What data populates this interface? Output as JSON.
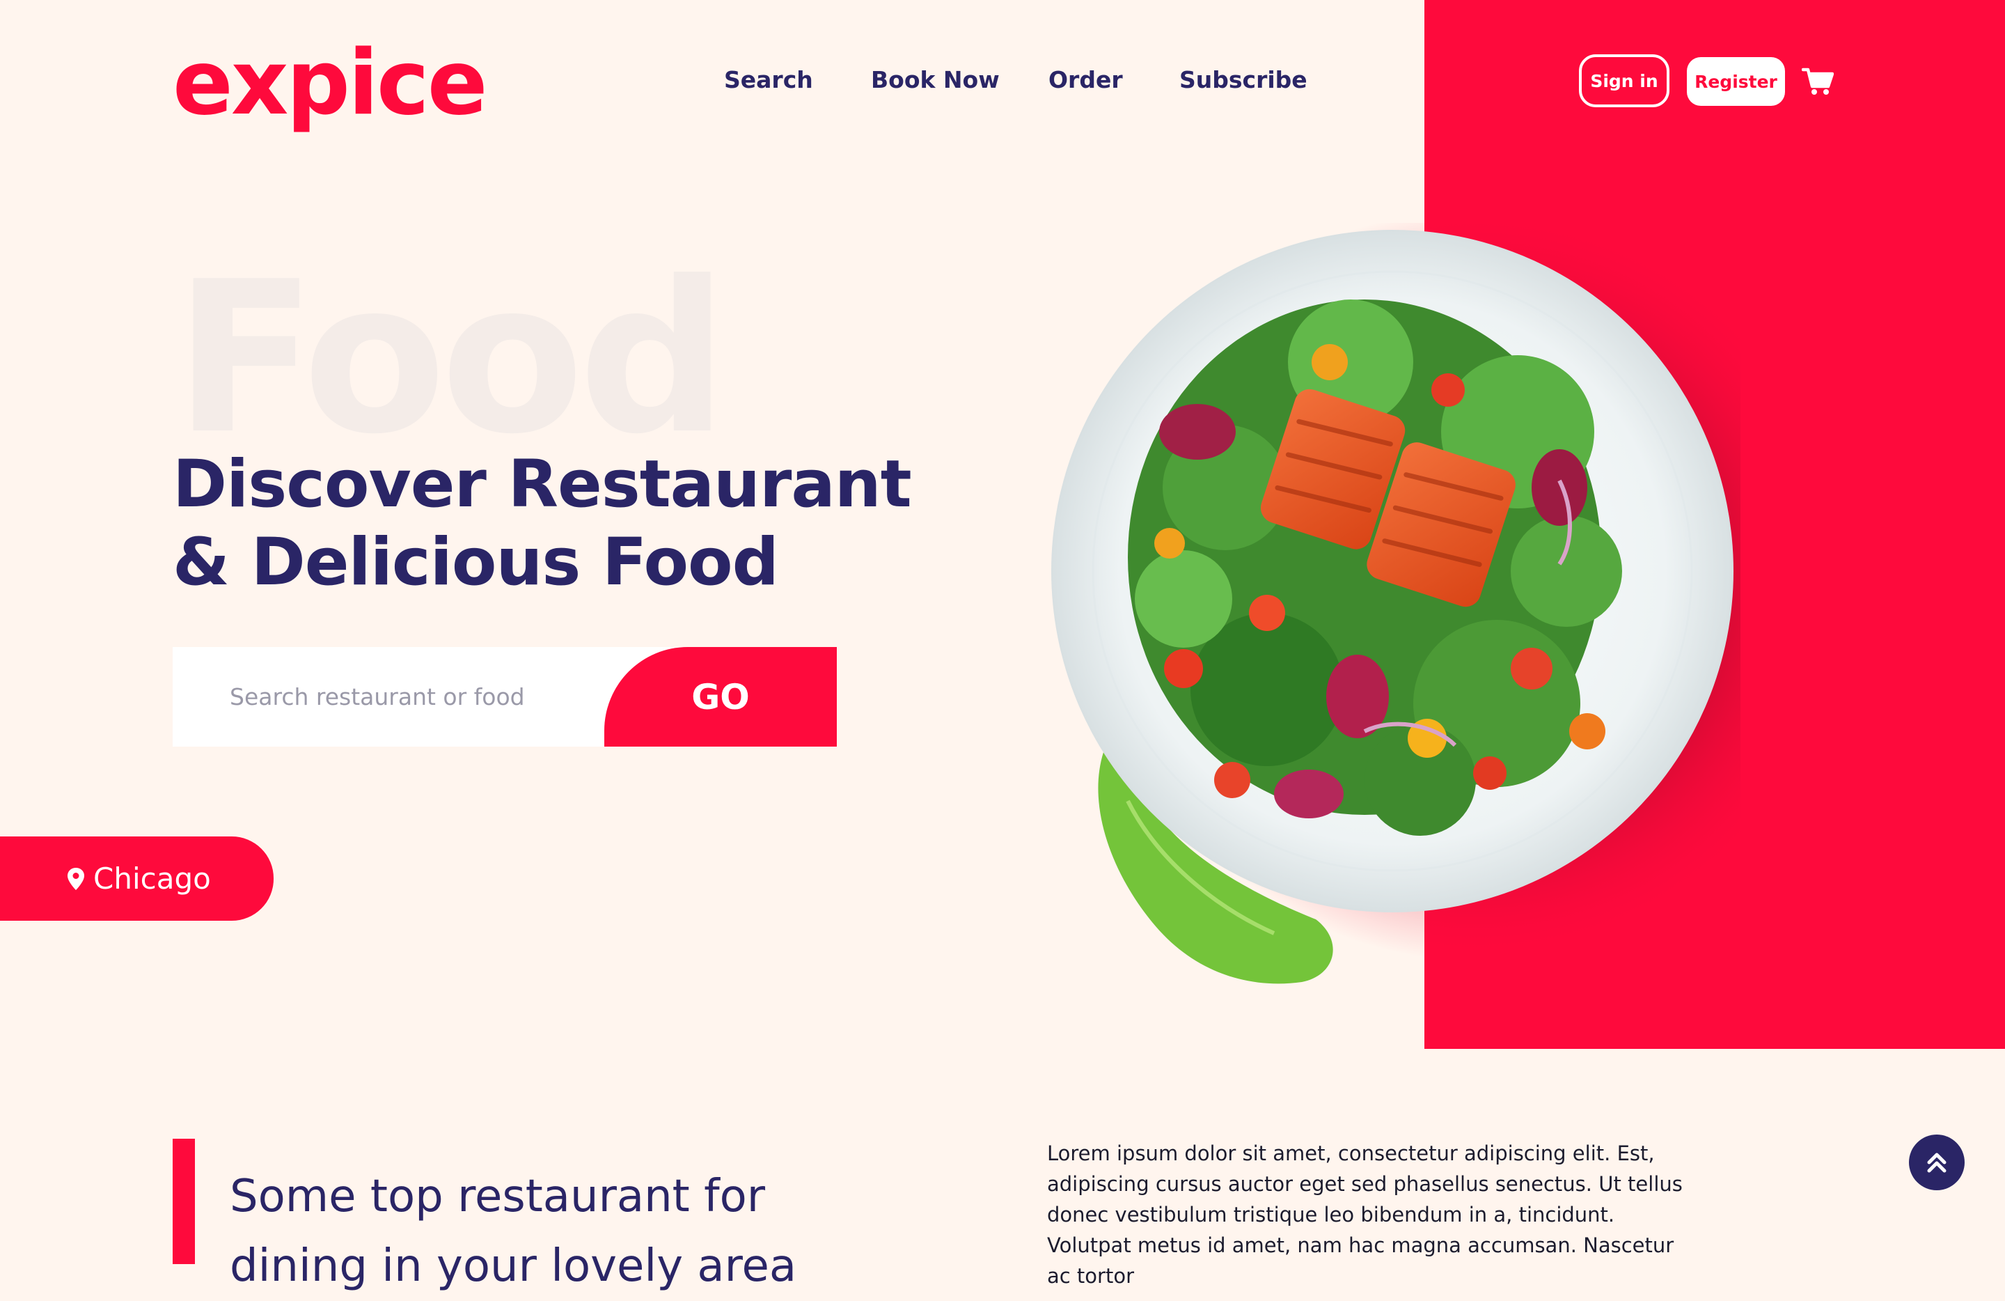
{
  "brand": {
    "logo": "expice"
  },
  "nav": {
    "items": [
      {
        "label": "Search"
      },
      {
        "label": "Book Now"
      },
      {
        "label": "Order"
      },
      {
        "label": "Subscribe"
      }
    ]
  },
  "auth": {
    "sign_in": "Sign in",
    "register": "Register"
  },
  "hero": {
    "bg_word": "Food",
    "title_line1": "Discover Restaurant",
    "title_line2": "& Delicious Food",
    "search_placeholder": "Search restaurant or food",
    "search_value": "",
    "go_label": "GO",
    "location": "Chicago"
  },
  "section": {
    "title": "Some top restaurant for dining in your lovely area",
    "body": "Lorem ipsum dolor sit amet, consectetur adipiscing elit. Est, adipiscing cursus auctor eget sed phasellus senectus. Ut tellus donec vestibulum tristique leo bibendum in a, tincidunt. Volutpat metus id amet, nam hac magna accumsan. Nascetur ac tortor"
  },
  "icons": {
    "cart": "cart-icon",
    "location": "map-pin-icon",
    "scroll_top": "double-chevron-up-icon"
  },
  "colors": {
    "accent": "#fe0a3c",
    "navy": "#2a2566",
    "background": "#fff5ee"
  }
}
